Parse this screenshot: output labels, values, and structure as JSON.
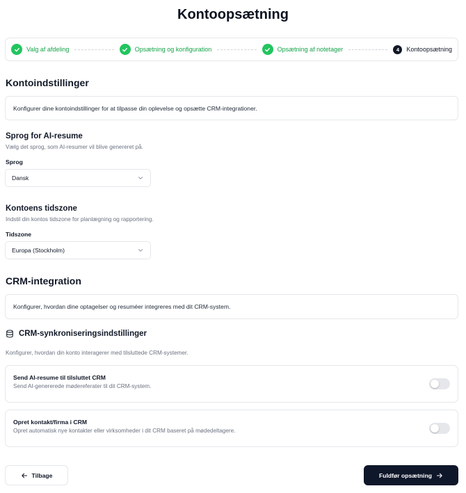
{
  "page": {
    "title": "Kontoopsætning"
  },
  "stepper": {
    "steps": [
      {
        "label": "Valg af afdeling",
        "state": "done"
      },
      {
        "label": "Opsætning og konfiguration",
        "state": "done"
      },
      {
        "label": "Opsætning af notetager",
        "state": "done"
      },
      {
        "label": "Kontoopsætning",
        "state": "active",
        "number": "4"
      }
    ]
  },
  "account_settings": {
    "heading": "Kontoindstillinger",
    "info": "Konfigurer dine kontoindstillinger for at tilpasse din oplevelse og opsætte CRM-integrationer."
  },
  "language": {
    "heading": "Sprog for AI-resume",
    "description": "Vælg det sprog, som AI-resumer vil blive genereret på.",
    "label": "Sprog",
    "value": "Dansk"
  },
  "timezone": {
    "heading": "Kontoens tidszone",
    "description": "Indstil din kontos tidszone for planlægning og rapportering.",
    "label": "Tidszone",
    "value": "Europa (Stockholm)"
  },
  "crm": {
    "heading": "CRM-integration",
    "info": "Konfigurer, hvordan dine optagelser og resuméer integreres med dit CRM-system.",
    "sync_title": "CRM-synkroniseringsindstillinger",
    "sync_description": "Konfigurer, hvordan din konto interagerer med tilsluttede CRM-systemer.",
    "options": [
      {
        "title": "Send AI-resume til tilsluttet CRM",
        "description": "Send AI-genererede mødereferater til dit CRM-system.",
        "enabled": false
      },
      {
        "title": "Opret kontakt/firma i CRM",
        "description": "Opret automatisk nye kontakter eller virksomheder i dit CRM baseret på mødedeltagere.",
        "enabled": false
      }
    ]
  },
  "footer": {
    "back_label": "Tilbage",
    "finish_label": "Fuldfør opsætning"
  },
  "colors": {
    "success": "#22c55e",
    "primary_button": "#0f172a",
    "toggle_off": "#e5e7eb"
  }
}
